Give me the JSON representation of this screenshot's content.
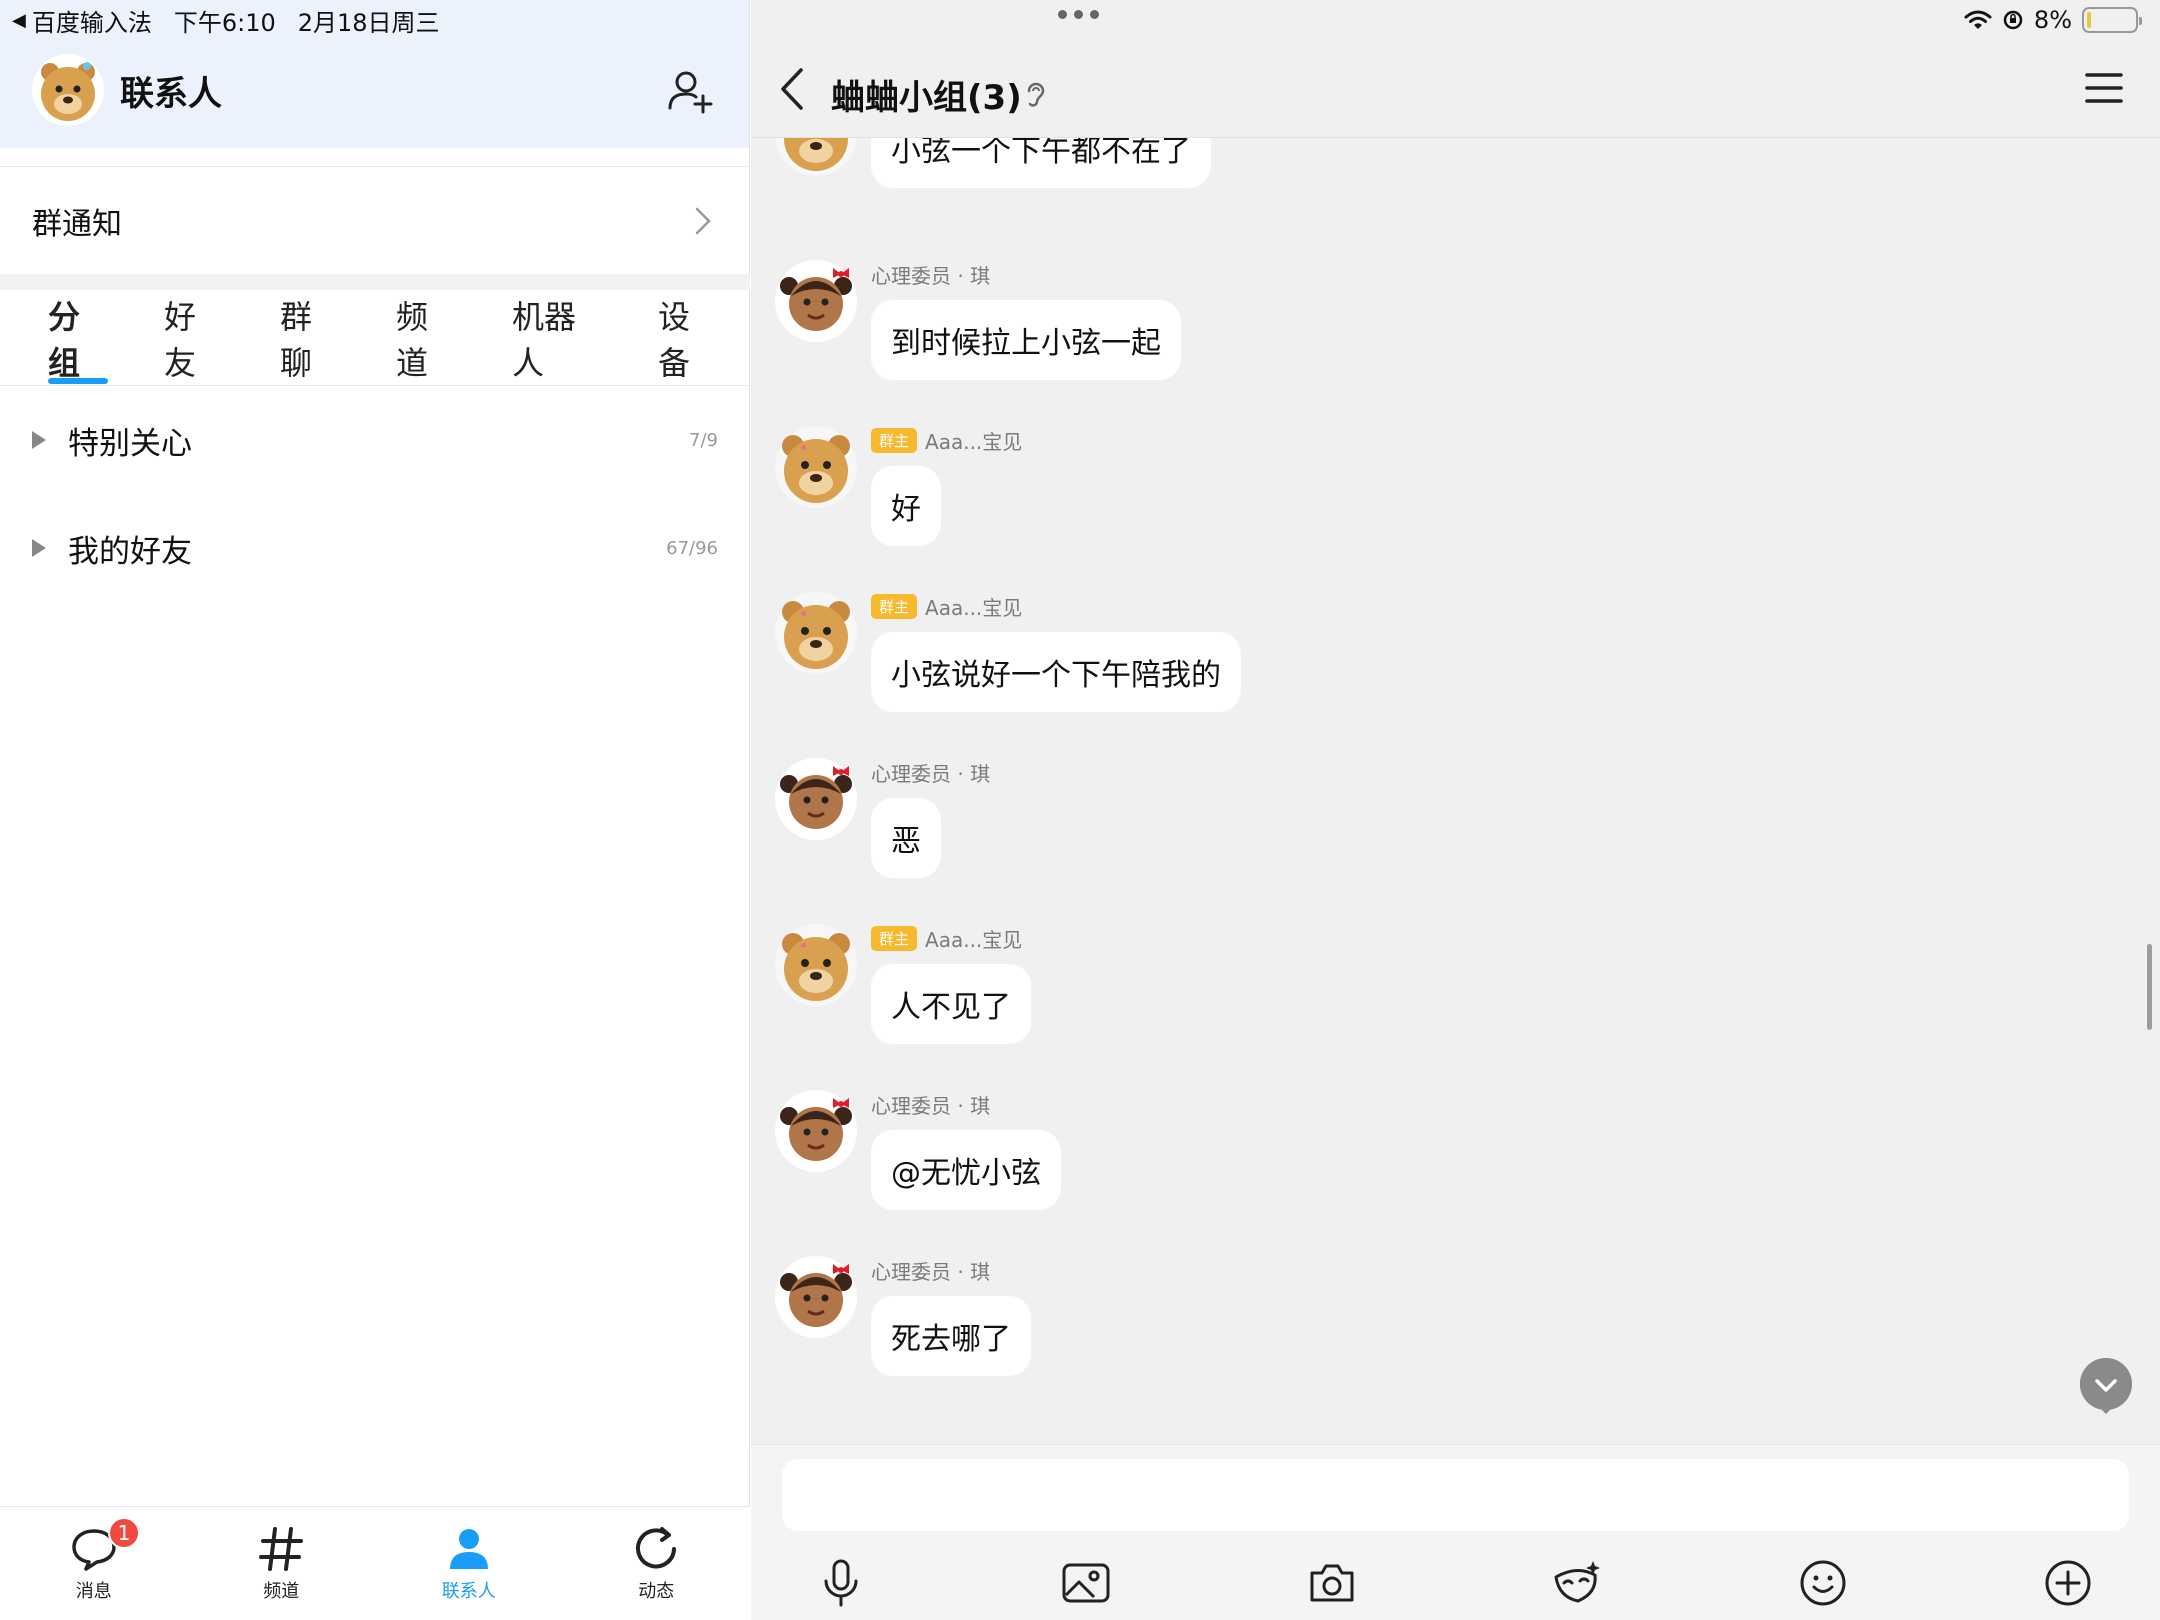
{
  "status": {
    "back_app": "百度输入法",
    "time": "下午6:10",
    "date": "2月18日周三",
    "battery": "8%",
    "battery_level": 0.08
  },
  "contacts": {
    "title": "联系人",
    "group_notice": "群通知",
    "tabs": [
      "分组",
      "好友",
      "群聊",
      "频道",
      "机器人",
      "设备"
    ],
    "active_tab": 0,
    "groups": [
      {
        "name": "特别关心",
        "count": "7/9"
      },
      {
        "name": "我的好友",
        "count": "67/96"
      }
    ]
  },
  "bottom_nav": {
    "items": [
      {
        "label": "消息",
        "icon": "message-icon",
        "badge": "1"
      },
      {
        "label": "频道",
        "icon": "hashtag-icon"
      },
      {
        "label": "联系人",
        "icon": "contact-icon"
      },
      {
        "label": "动态",
        "icon": "refresh-icon"
      }
    ],
    "active": 2
  },
  "chat": {
    "title": "蛐蛐小组(3)",
    "owner_tag": "群主",
    "messages": [
      {
        "avatar": "bear",
        "sender": "",
        "owner": false,
        "text": "小弦一个下午都不在了"
      },
      {
        "avatar": "girl",
        "sender": "心理委员 · 琪",
        "owner": false,
        "text": "到时候拉上小弦一起"
      },
      {
        "avatar": "bear",
        "sender": "Aaa...宝见",
        "owner": true,
        "text": "好"
      },
      {
        "avatar": "bear",
        "sender": "Aaa...宝见",
        "owner": true,
        "text": "小弦说好一个下午陪我的"
      },
      {
        "avatar": "girl",
        "sender": "心理委员 · 琪",
        "owner": false,
        "text": "恶"
      },
      {
        "avatar": "bear",
        "sender": "Aaa...宝见",
        "owner": true,
        "text": "人不见了"
      },
      {
        "avatar": "girl",
        "sender": "心理委员 · 琪",
        "owner": false,
        "text": "@无忧小弦"
      },
      {
        "avatar": "girl",
        "sender": "心理委员 · 琪",
        "owner": false,
        "text": "死去哪了"
      }
    ],
    "toolbar": [
      "microphone-icon",
      "image-icon",
      "camera-icon",
      "mask-icon",
      "emoji-icon",
      "plus-icon"
    ]
  },
  "colors": {
    "accent": "#1a9df7",
    "badge": "#f04a3e",
    "owner_tag": "#f7b92d",
    "header_bg": "#ecf2fd",
    "chat_bg": "#f0f0f0"
  }
}
